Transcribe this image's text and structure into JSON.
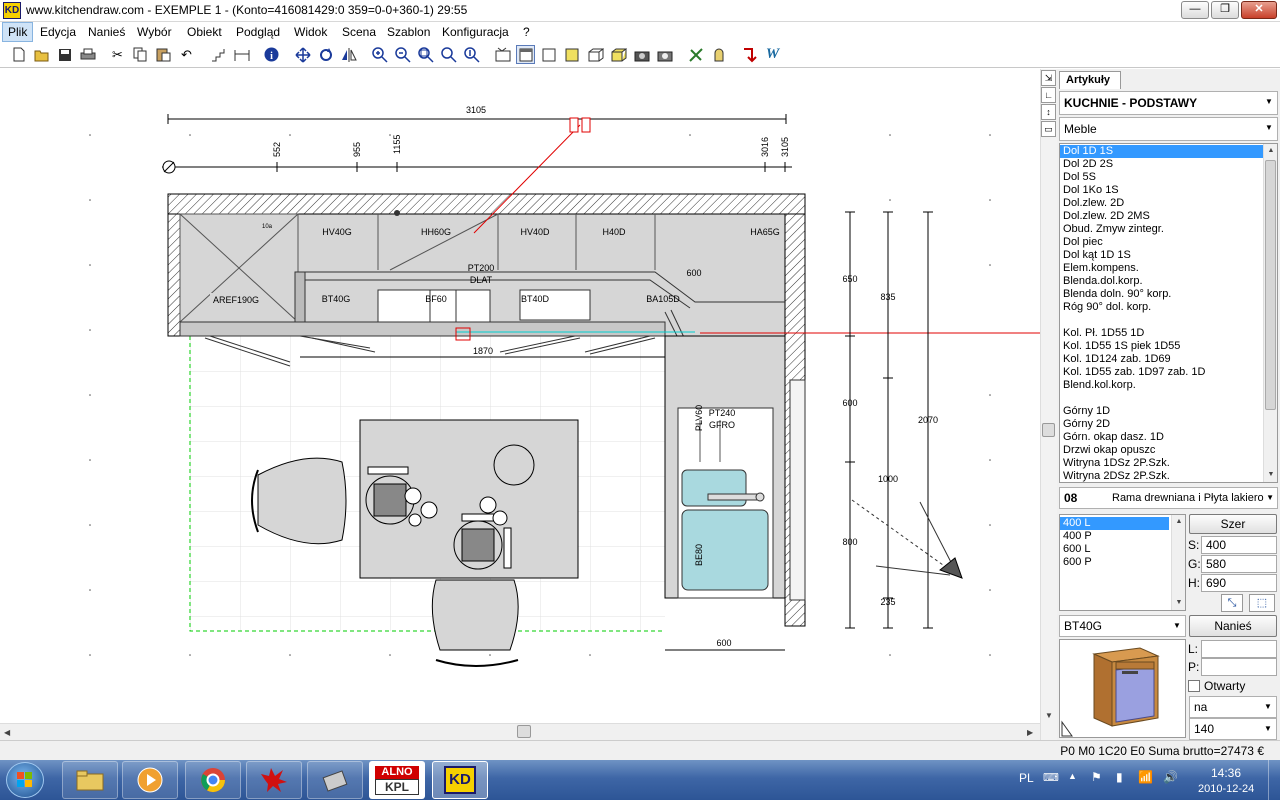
{
  "window": {
    "logo": "KD",
    "title": "www.kitchendraw.com - EXEMPLE 1 - (Konto=416081429:0 359=0-0+360-1) 29:55"
  },
  "menu": [
    "Plik",
    "Edycja",
    "Nanieś",
    "Wybór",
    "Obiekt",
    "Podgląd",
    "Widok",
    "Scena",
    "Szablon",
    "Konfiguracja",
    "?"
  ],
  "toolbar": {
    "icons": [
      "new-icon",
      "open-icon",
      "save-icon",
      "print-icon",
      "cut-icon",
      "copy-icon",
      "paste-icon",
      "undo-icon",
      "stairs-icon",
      "dimension-icon",
      "info-icon",
      "move-icon",
      "rotate-icon",
      "mirror-icon",
      "zoom-in-icon",
      "zoom-out-icon",
      "zoom-window-icon",
      "zoom-fit-icon",
      "zoom-all-icon",
      "plan-view-icon",
      "plan-view-active-icon",
      "wall-view-icon",
      "elevation-icon",
      "perspective-icon",
      "box-icon",
      "camera-icon",
      "camera2-icon",
      "render-icon",
      "lamp-icon",
      "arrow-export-icon",
      "web-icon"
    ]
  },
  "plan": {
    "overall_dim": "3105",
    "dims_top": [
      "552",
      "955",
      "1155",
      "3016",
      "3105"
    ],
    "labels": {
      "aref": "AREF190G",
      "hv40g": "HV40G",
      "hh60g": "HH60G",
      "hv40d": "HV40D",
      "h40d": "H40D",
      "ha65g": "HA65G",
      "pt200": "PT200",
      "dlat": "DLAT",
      "bt40g": "BT40G",
      "bf60": "BF60",
      "bt40d": "BT40D",
      "ba105d": "BA105D",
      "dim600a": "600",
      "dim1870": "1870",
      "plv60": "PLV60",
      "pt240": "PT240",
      "gfro": "GFRO",
      "be80": "BE80",
      "dim600b": "600",
      "dim10a": "10a"
    },
    "side_dims": [
      "650",
      "835",
      "600",
      "2070",
      "1000",
      "800",
      "235"
    ]
  },
  "panel": {
    "tab_label": "Artykuły",
    "category": "KUCHNIE - PODSTAWY",
    "subcategory": "Meble",
    "items": [
      "Dol 1D 1S",
      "Dol 2D 2S",
      "Dol 5S",
      "Dol 1Ko 1S",
      "Dol.zlew. 2D",
      "Dol.zlew. 2D 2MS",
      "Obud. Zmyw zintegr.",
      "Dol piec",
      "Dol kąt 1D 1S",
      "Elem.kompens.",
      "Blenda.dol.korp.",
      "Blenda  doln. 90° korp.",
      "Róg 90° dol. korp.",
      "",
      "Kol. Pł. 1D55 1D",
      "Kol. 1D55 1S piek 1D55",
      "Kol. 1D124 zab. 1D69",
      "Kol. 1D55 zab. 1D97 zab. 1D",
      "Blend.kol.korp.",
      "",
      "Górny 1D",
      "Górny 2D",
      "Górn. okap dasz. 1D",
      "Drzwi okap opuszc",
      "Witryna 1DSz 2P.Szk.",
      "Witryna 2DSz 2P.Szk."
    ],
    "selected_index": 0,
    "finish_code": "08",
    "finish_name": "Rama drewniana i Płyta lakiero",
    "sizes": [
      "400 L",
      "400  P",
      "600 L",
      "600  P"
    ],
    "size_selected": 0,
    "width_button": "Szer",
    "s_label": "S:",
    "s_value": "400",
    "g_label": "G:",
    "g_value": "580",
    "h_label": "H:",
    "h_value": "690",
    "model": "BT40G",
    "place_button": "Nanieś",
    "l_label": "L:",
    "p_label": "P:",
    "open_label": "Otwarty",
    "hinge": "na",
    "height_value": "140"
  },
  "status": "P0 M0 1C20 E0 Suma brutto=27473 €",
  "taskbar": {
    "apps": [
      "file-explorer-icon",
      "media-player-icon",
      "chrome-icon",
      "paint-splash-icon",
      "tools-icon",
      "alno-kpl-icon",
      "kitchendraw-icon"
    ],
    "alno": "ALNO",
    "kpl": "KPL",
    "kd": "KD",
    "lang": "PL",
    "time": "14:36",
    "date": "2010-12-24"
  },
  "colors": {
    "accent": "#3399ff",
    "counter": "#d6d6d6",
    "sink": "#a9d9df",
    "red_line": "#e00000",
    "green_dash": "#00cc00"
  }
}
